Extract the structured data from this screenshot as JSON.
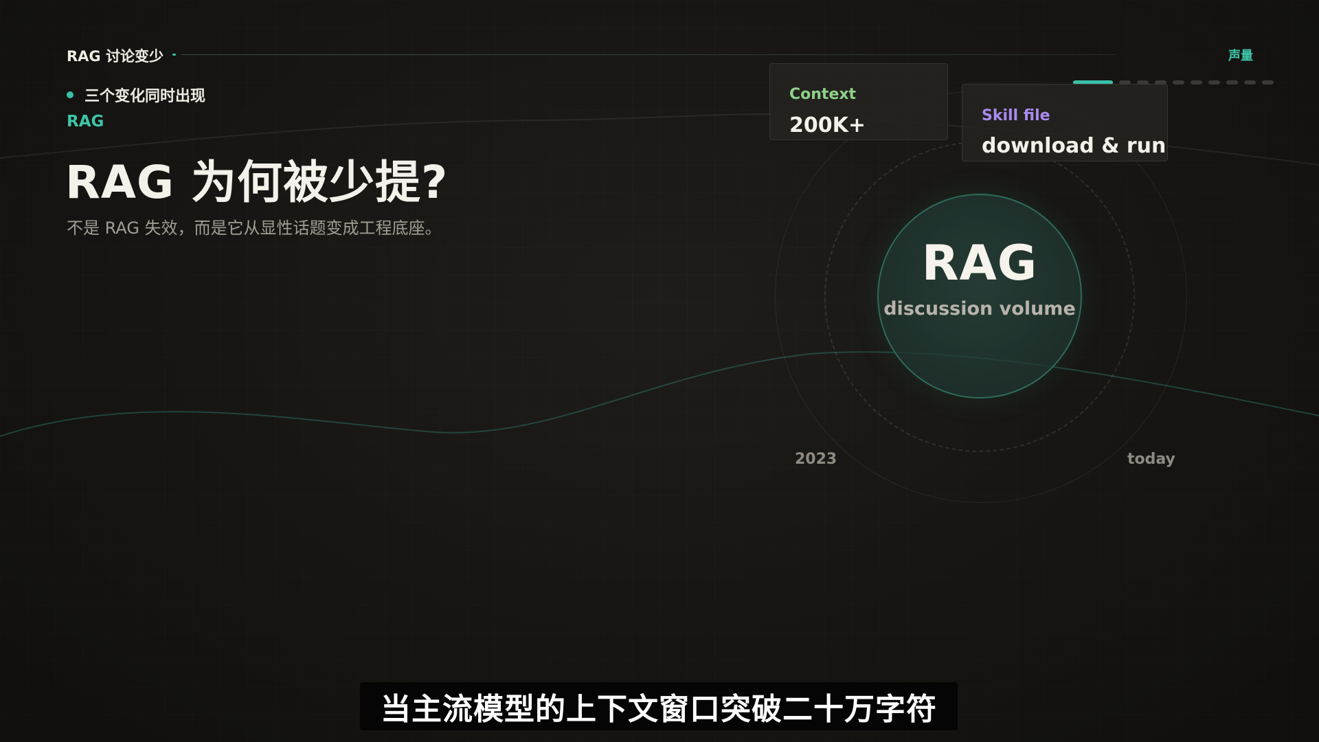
{
  "topbar": {
    "title": "RAG 讨论变少",
    "right_label": "声量",
    "progress_total": 10,
    "progress_active_index": 0
  },
  "bullet": {
    "text": "三个变化同时出现"
  },
  "eyebrow": "RAG",
  "headline": "RAG 为何被少提?",
  "subhead": "不是 RAG 失效，而是它从显性话题变成工程底座。",
  "core": {
    "title": "RAG",
    "subtitle": "discussion volume"
  },
  "cards": {
    "context": {
      "key": "Context",
      "value": "200K+"
    },
    "skill": {
      "key": "Skill file",
      "value": "download & run"
    }
  },
  "timeline": {
    "start": "2023",
    "end": "today"
  },
  "caption": "当主流模型的上下文窗口突破二十万字符",
  "colors": {
    "accent_teal": "#3ac0a6",
    "context_key": "#8fd18a",
    "skill_key": "#a98af0",
    "background": "#1a1815"
  }
}
